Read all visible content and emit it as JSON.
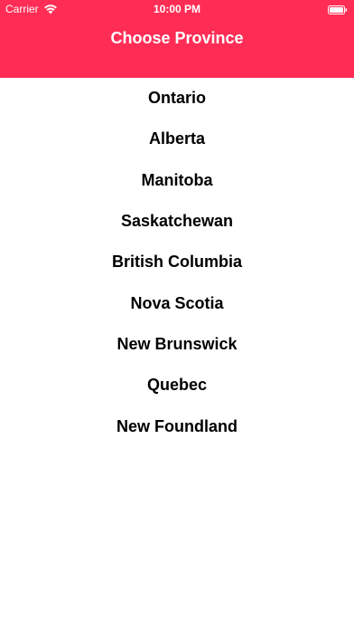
{
  "status_bar": {
    "carrier": "Carrier",
    "time": "10:00 PM",
    "wifi_icon": "wifi-icon",
    "battery_icon": "battery-icon"
  },
  "header": {
    "title": "Choose Province",
    "color": "#ff2d55"
  },
  "provinces": [
    "Ontario",
    "Alberta",
    "Manitoba",
    "Saskatchewan",
    "British Columbia",
    "Nova Scotia",
    "New Brunswick",
    "Quebec",
    "New Foundland"
  ]
}
